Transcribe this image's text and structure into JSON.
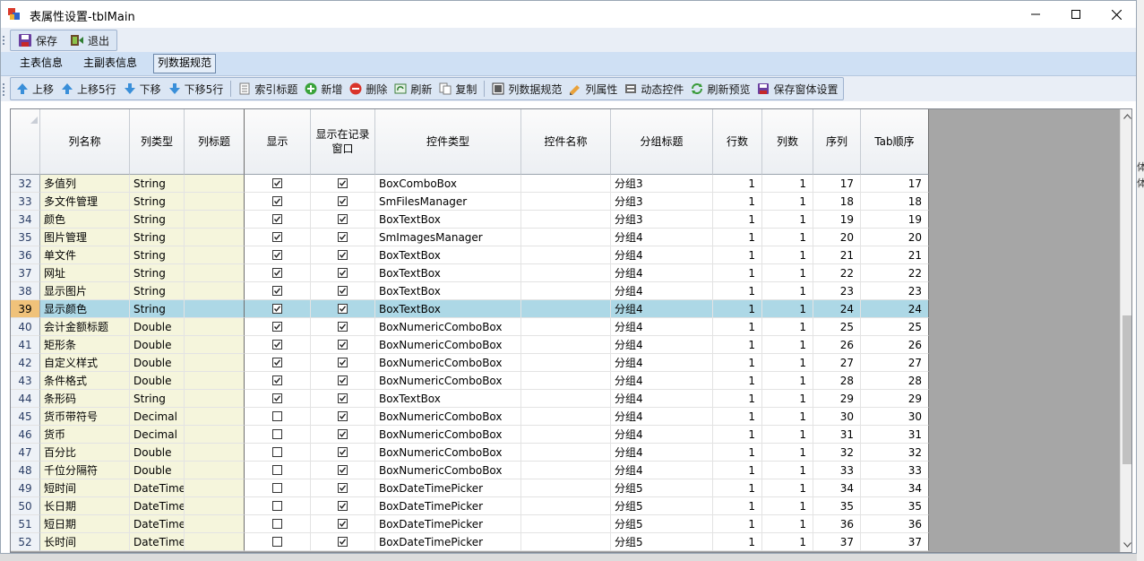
{
  "window": {
    "title": "表属性设置-tblMain",
    "right_strip_chars": [
      "体",
      "体"
    ]
  },
  "toolbar1": {
    "save_label": "保存",
    "exit_label": "退出"
  },
  "tabs": [
    {
      "label": "主表信息",
      "active": false
    },
    {
      "label": "主副表信息",
      "active": false
    },
    {
      "label": "列数据规范",
      "active": true
    }
  ],
  "toolbar2": {
    "move_up": "上移",
    "move_up5": "上移5行",
    "move_down": "下移",
    "move_down5": "下移5行",
    "index_title": "索引标题",
    "add": "新增",
    "delete": "删除",
    "refresh": "刷新",
    "copy": "复制",
    "col_spec": "列数据规范",
    "col_props": "列属性",
    "dyn_ctrl": "动态控件",
    "refresh_preview": "刷新预览",
    "save_form": "保存窗体设置"
  },
  "grid": {
    "columns": [
      "列名称",
      "列类型",
      "列标题",
      "显示",
      "显示在记录窗口",
      "控件类型",
      "控件名称",
      "分组标题",
      "行数",
      "列数",
      "序列",
      "Tab顺序"
    ],
    "selected_row_index": 7,
    "rows": [
      {
        "n": "32",
        "name": "多值列",
        "type": "String",
        "title": "",
        "show": true,
        "rec": true,
        "ctrl": "BoxComboBox",
        "cname": "",
        "group": "分组3",
        "rows": "1",
        "cols": "1",
        "seq": "17",
        "tab": "17"
      },
      {
        "n": "33",
        "name": "多文件管理",
        "type": "String",
        "title": "",
        "show": true,
        "rec": true,
        "ctrl": "SmFilesManager",
        "cname": "",
        "group": "分组3",
        "rows": "1",
        "cols": "1",
        "seq": "18",
        "tab": "18"
      },
      {
        "n": "34",
        "name": "颜色",
        "type": "String",
        "title": "",
        "show": true,
        "rec": true,
        "ctrl": "BoxTextBox",
        "cname": "",
        "group": "分组3",
        "rows": "1",
        "cols": "1",
        "seq": "19",
        "tab": "19"
      },
      {
        "n": "35",
        "name": "图片管理",
        "type": "String",
        "title": "",
        "show": true,
        "rec": true,
        "ctrl": "SmImagesManager",
        "cname": "",
        "group": "分组4",
        "rows": "1",
        "cols": "1",
        "seq": "20",
        "tab": "20"
      },
      {
        "n": "36",
        "name": "单文件",
        "type": "String",
        "title": "",
        "show": true,
        "rec": true,
        "ctrl": "BoxTextBox",
        "cname": "",
        "group": "分组4",
        "rows": "1",
        "cols": "1",
        "seq": "21",
        "tab": "21"
      },
      {
        "n": "37",
        "name": "网址",
        "type": "String",
        "title": "",
        "show": true,
        "rec": true,
        "ctrl": "BoxTextBox",
        "cname": "",
        "group": "分组4",
        "rows": "1",
        "cols": "1",
        "seq": "22",
        "tab": "22"
      },
      {
        "n": "38",
        "name": "显示图片",
        "type": "String",
        "title": "",
        "show": true,
        "rec": true,
        "ctrl": "BoxTextBox",
        "cname": "",
        "group": "分组4",
        "rows": "1",
        "cols": "1",
        "seq": "23",
        "tab": "23"
      },
      {
        "n": "39",
        "name": "显示颜色",
        "type": "String",
        "title": "",
        "show": true,
        "rec": true,
        "ctrl": "BoxTextBox",
        "cname": "",
        "group": "分组4",
        "rows": "1",
        "cols": "1",
        "seq": "24",
        "tab": "24"
      },
      {
        "n": "40",
        "name": "会计金额标题",
        "type": "Double",
        "title": "",
        "show": true,
        "rec": true,
        "ctrl": "BoxNumericComboBox",
        "cname": "",
        "group": "分组4",
        "rows": "1",
        "cols": "1",
        "seq": "25",
        "tab": "25"
      },
      {
        "n": "41",
        "name": "矩形条",
        "type": "Double",
        "title": "",
        "show": true,
        "rec": true,
        "ctrl": "BoxNumericComboBox",
        "cname": "",
        "group": "分组4",
        "rows": "1",
        "cols": "1",
        "seq": "26",
        "tab": "26"
      },
      {
        "n": "42",
        "name": "自定义样式",
        "type": "Double",
        "title": "",
        "show": true,
        "rec": true,
        "ctrl": "BoxNumericComboBox",
        "cname": "",
        "group": "分组4",
        "rows": "1",
        "cols": "1",
        "seq": "27",
        "tab": "27"
      },
      {
        "n": "43",
        "name": "条件格式",
        "type": "Double",
        "title": "",
        "show": true,
        "rec": true,
        "ctrl": "BoxNumericComboBox",
        "cname": "",
        "group": "分组4",
        "rows": "1",
        "cols": "1",
        "seq": "28",
        "tab": "28"
      },
      {
        "n": "44",
        "name": "条形码",
        "type": "String",
        "title": "",
        "show": true,
        "rec": true,
        "ctrl": "BoxTextBox",
        "cname": "",
        "group": "分组4",
        "rows": "1",
        "cols": "1",
        "seq": "29",
        "tab": "29"
      },
      {
        "n": "45",
        "name": "货币带符号",
        "type": "Decimal",
        "title": "",
        "show": false,
        "rec": true,
        "ctrl": "BoxNumericComboBox",
        "cname": "",
        "group": "分组4",
        "rows": "1",
        "cols": "1",
        "seq": "30",
        "tab": "30"
      },
      {
        "n": "46",
        "name": "货币",
        "type": "Decimal",
        "title": "",
        "show": false,
        "rec": true,
        "ctrl": "BoxNumericComboBox",
        "cname": "",
        "group": "分组4",
        "rows": "1",
        "cols": "1",
        "seq": "31",
        "tab": "31"
      },
      {
        "n": "47",
        "name": "百分比",
        "type": "Double",
        "title": "",
        "show": false,
        "rec": true,
        "ctrl": "BoxNumericComboBox",
        "cname": "",
        "group": "分组4",
        "rows": "1",
        "cols": "1",
        "seq": "32",
        "tab": "32"
      },
      {
        "n": "48",
        "name": "千位分隔符",
        "type": "Double",
        "title": "",
        "show": false,
        "rec": true,
        "ctrl": "BoxNumericComboBox",
        "cname": "",
        "group": "分组4",
        "rows": "1",
        "cols": "1",
        "seq": "33",
        "tab": "33"
      },
      {
        "n": "49",
        "name": "短时间",
        "type": "DateTime",
        "title": "",
        "show": false,
        "rec": true,
        "ctrl": "BoxDateTimePicker",
        "cname": "",
        "group": "分组5",
        "rows": "1",
        "cols": "1",
        "seq": "34",
        "tab": "34"
      },
      {
        "n": "50",
        "name": "长日期",
        "type": "DateTime",
        "title": "",
        "show": false,
        "rec": true,
        "ctrl": "BoxDateTimePicker",
        "cname": "",
        "group": "分组5",
        "rows": "1",
        "cols": "1",
        "seq": "35",
        "tab": "35"
      },
      {
        "n": "51",
        "name": "短日期",
        "type": "DateTime",
        "title": "",
        "show": false,
        "rec": true,
        "ctrl": "BoxDateTimePicker",
        "cname": "",
        "group": "分组5",
        "rows": "1",
        "cols": "1",
        "seq": "36",
        "tab": "36"
      },
      {
        "n": "52",
        "name": "长时间",
        "type": "DateTime",
        "title": "",
        "show": false,
        "rec": true,
        "ctrl": "BoxDateTimePicker",
        "cname": "",
        "group": "分组5",
        "rows": "1",
        "cols": "1",
        "seq": "37",
        "tab": "37"
      }
    ]
  },
  "colors": {
    "selected_row": "#add8e6",
    "selected_header": "#f0c27a",
    "name_column_bg": "#f5f5dc",
    "toolbar_bg": "#dbe6f4"
  }
}
